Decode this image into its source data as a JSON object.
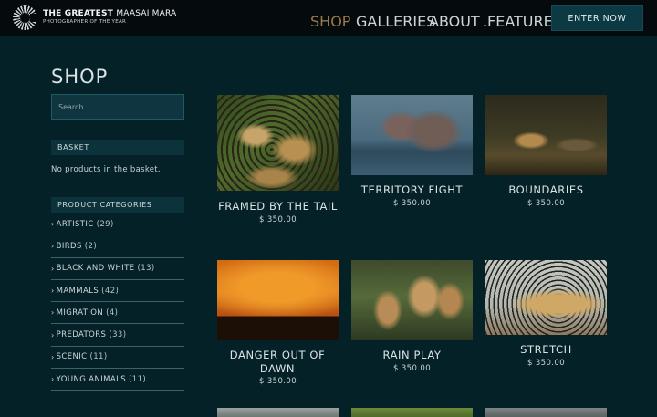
{
  "header": {
    "logo": {
      "line1_bold": "THE GREATEST",
      "line1_thin": "MAASAI MARA",
      "line2": "PHOTOGRAPHER OF THE YEAR"
    },
    "nav": [
      {
        "label": "SHOP",
        "active": true,
        "caret": false
      },
      {
        "label": "GALLERIES",
        "active": false,
        "caret": true
      },
      {
        "label": "ABOUT",
        "active": false,
        "caret": true
      },
      {
        "label": "FEATURED",
        "active": false,
        "caret": false
      }
    ],
    "cta_label": "ENTER NOW"
  },
  "sidebar": {
    "title": "SHOP",
    "search_placeholder": "Search...",
    "basket": {
      "heading": "BASKET",
      "empty_text": "No products in the basket."
    },
    "categories": {
      "heading": "PRODUCT CATEGORIES",
      "items": [
        {
          "label": "ARTISTIC",
          "count": "(29)"
        },
        {
          "label": "BIRDS",
          "count": "(2)"
        },
        {
          "label": "BLACK AND WHITE",
          "count": "(13)"
        },
        {
          "label": "MAMMALS",
          "count": "(42)"
        },
        {
          "label": "MIGRATION",
          "count": "(4)"
        },
        {
          "label": "PREDATORS",
          "count": "(33)"
        },
        {
          "label": "SCENIC",
          "count": "(11)"
        },
        {
          "label": "YOUNG ANIMALS",
          "count": "(11)"
        }
      ]
    }
  },
  "products": [
    {
      "name": "FRAMED BY THE TAIL",
      "price": "$ 350.00",
      "image_icon": "leopards-photo"
    },
    {
      "name": "TERRITORY FIGHT",
      "price": "$ 350.00",
      "image_icon": "hippo-photo"
    },
    {
      "name": "BOUNDARIES",
      "price": "$ 350.00",
      "image_icon": "cheetah-photo"
    },
    {
      "name": "DANGER OUT OF DAWN",
      "price": "$ 350.00",
      "image_icon": "wildebeest-dawn-photo"
    },
    {
      "name": "RAIN PLAY",
      "price": "$ 350.00",
      "image_icon": "lion-cubs-photo"
    },
    {
      "name": "STRETCH",
      "price": "$ 350.00",
      "image_icon": "leopard-stretch-photo"
    }
  ],
  "colors": {
    "background": "#052128",
    "header": "#050b0d",
    "accent_active": "#9a7a4f",
    "button": "#0c3a44"
  }
}
